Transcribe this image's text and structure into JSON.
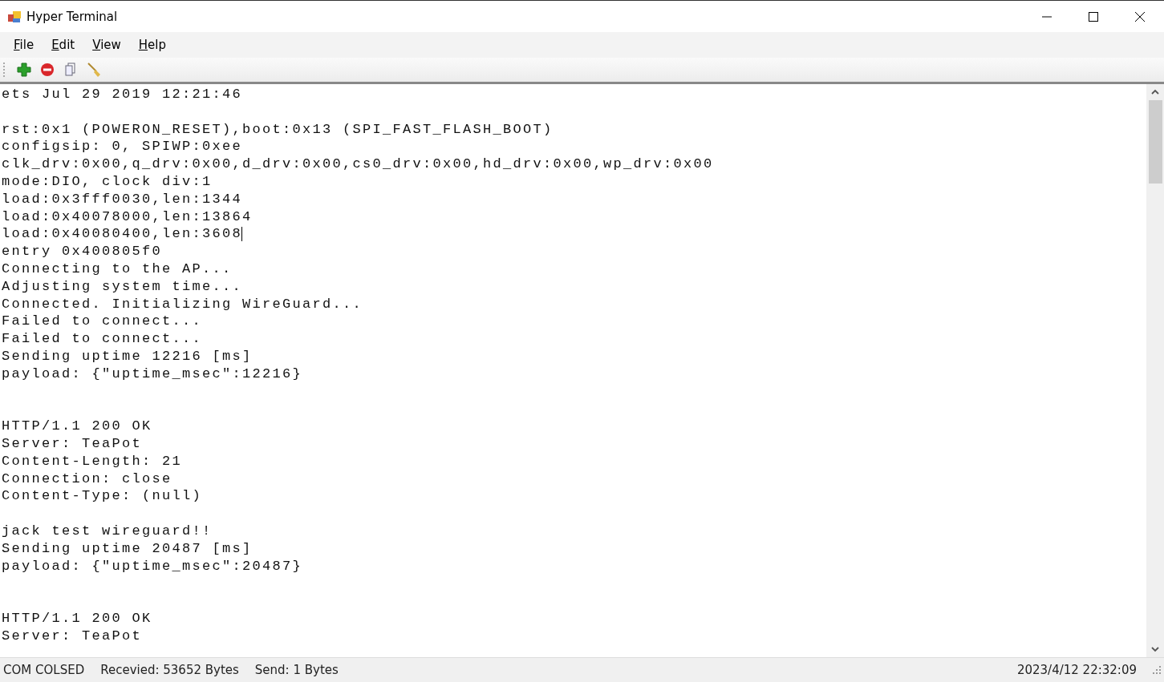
{
  "window": {
    "title": "Hyper Terminal"
  },
  "menu": [
    {
      "label": "File"
    },
    {
      "label": "Edit"
    },
    {
      "label": "View"
    },
    {
      "label": "Help"
    }
  ],
  "toolbar": [
    {
      "kind": "add"
    },
    {
      "kind": "stop"
    },
    {
      "kind": "copy"
    },
    {
      "kind": "clear"
    }
  ],
  "terminal": {
    "lines": [
      {
        "kind": "text",
        "text": "ets Jul 29 2019 12:21:46"
      },
      {
        "kind": "blank"
      },
      {
        "kind": "text",
        "text": "rst:0x1 (POWERON_RESET),boot:0x13 (SPI_FAST_FLASH_BOOT)"
      },
      {
        "kind": "text",
        "text": "configsip: 0, SPIWP:0xee"
      },
      {
        "kind": "text",
        "text": "clk_drv:0x00,q_drv:0x00,d_drv:0x00,cs0_drv:0x00,hd_drv:0x00,wp_drv:0x00"
      },
      {
        "kind": "text",
        "text": "mode:DIO, clock div:1"
      },
      {
        "kind": "text",
        "text": "load:0x3fff0030,len:1344"
      },
      {
        "kind": "text",
        "text": "load:0x40078000,len:13864"
      },
      {
        "kind": "text",
        "text": "load:0x40080400,len:3608",
        "cursor": true
      },
      {
        "kind": "text",
        "text": "entry 0x400805f0"
      },
      {
        "kind": "text",
        "text": "Connecting to the AP..."
      },
      {
        "kind": "text",
        "text": "Adjusting system time..."
      },
      {
        "kind": "text",
        "text": "Connected. Initializing WireGuard..."
      },
      {
        "kind": "text",
        "text": "Failed to connect..."
      },
      {
        "kind": "text",
        "text": "Failed to connect..."
      },
      {
        "kind": "text",
        "text": "Sending uptime 12216 [ms]"
      },
      {
        "kind": "text",
        "text": "payload: {\"uptime_msec\":12216}"
      },
      {
        "kind": "blank"
      },
      {
        "kind": "blank"
      },
      {
        "kind": "text",
        "text": "HTTP/1.1 200 OK"
      },
      {
        "kind": "text",
        "text": "Server: TeaPot"
      },
      {
        "kind": "text",
        "text": "Content-Length: 21"
      },
      {
        "kind": "text",
        "text": "Connection: close"
      },
      {
        "kind": "text",
        "text": "Content-Type: (null)"
      },
      {
        "kind": "blank"
      },
      {
        "kind": "text",
        "text": "jack test wireguard!!"
      },
      {
        "kind": "text",
        "text": "Sending uptime 20487 [ms]"
      },
      {
        "kind": "text",
        "text": "payload: {\"uptime_msec\":20487}"
      },
      {
        "kind": "blank"
      },
      {
        "kind": "blank"
      },
      {
        "kind": "text",
        "text": "HTTP/1.1 200 OK"
      },
      {
        "kind": "text",
        "text": "Server: TeaPot"
      }
    ]
  },
  "status_bar": {
    "port": "COM COLSED",
    "received": "Recevied: 53652 Bytes",
    "sent": "Send: 1 Bytes",
    "time": "2023/4/12 22:32:09"
  }
}
